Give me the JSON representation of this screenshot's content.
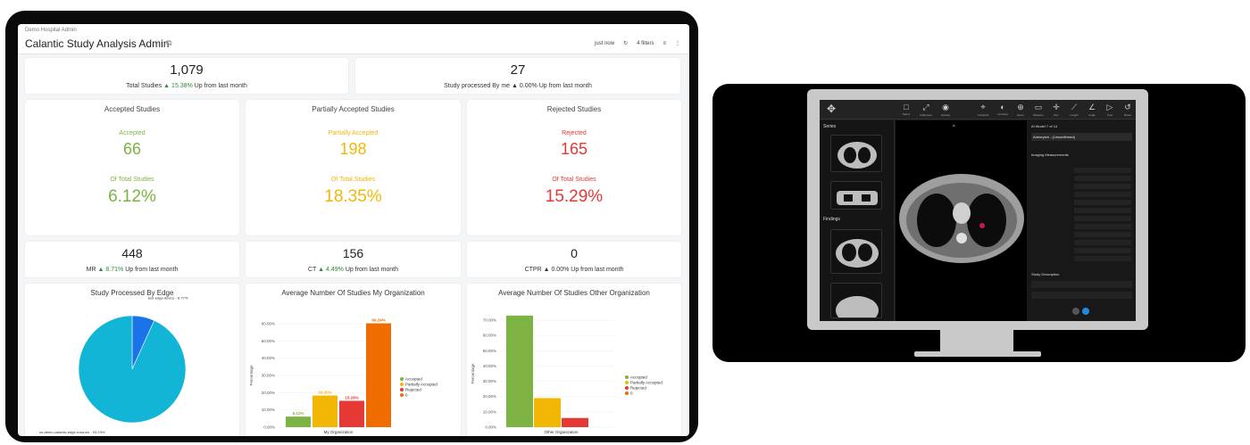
{
  "dashboard": {
    "breadcrumb": "Demo Hospital Admin",
    "title": "Calantic Study Analysis Admin",
    "refresh_text": "just now",
    "filters_text": "4 filters"
  },
  "kpi_top": [
    {
      "value": "1,079",
      "label": "Total Studies",
      "delta": "15.38%",
      "suffix": "Up from last month"
    },
    {
      "value": "27",
      "label": "Study processed By me",
      "delta": "0.00%",
      "suffix": "Up from last month"
    }
  ],
  "status_cards": [
    {
      "title": "Accepted Studies",
      "label": "Accepted",
      "count": "66",
      "pct_label": "Of Total Studies",
      "pct": "6.12%",
      "color": "#7cb342"
    },
    {
      "title": "Partially Accepted Studies",
      "label": "Partially Accepted",
      "count": "198",
      "pct_label": "Of Total Studies",
      "pct": "18.35%",
      "color": "#f2b705"
    },
    {
      "title": "Rejected Studies",
      "label": "Rejected",
      "count": "165",
      "pct_label": "Of Total Studies",
      "pct": "15.29%",
      "color": "#e53935"
    }
  ],
  "modality_cards": [
    {
      "value": "448",
      "label": "MR",
      "delta": "8.71%",
      "suffix": "Up from last month"
    },
    {
      "value": "156",
      "label": "CT",
      "delta": "4.49%",
      "suffix": "Up from last month"
    },
    {
      "value": "0",
      "label": "CTPR",
      "delta": "0.00%",
      "suffix": "Up from last month"
    }
  ],
  "chart_data": [
    {
      "type": "pie",
      "title": "Study Processed By Edge",
      "slices": [
        {
          "label": "test-edge-device - 6.77%",
          "value": 6.77,
          "color": "#1a73e8"
        },
        {
          "label": "us-demo-calantic-edge-rosa-wn - 93.23%",
          "value": 93.23,
          "color": "#13b5d6"
        }
      ]
    },
    {
      "type": "bar",
      "title": "Average Number Of Studies My Organization",
      "xlabel": "My Organization",
      "ylabel": "Percentage",
      "yticks": [
        "0.00%",
        "10.00%",
        "20.00%",
        "30.00%",
        "40.00%",
        "50.00%",
        "60.00%"
      ],
      "ylim": [
        0,
        60
      ],
      "series": [
        {
          "name": "Accepted",
          "value": 6.12,
          "label": "6.12%",
          "color": "#7cb342"
        },
        {
          "name": "Partially Accepted",
          "value": 18.35,
          "label": "18.35%",
          "color": "#f2b705"
        },
        {
          "name": "Rejected",
          "value": 15.29,
          "label": "15.29%",
          "color": "#e53935"
        },
        {
          "name": "0",
          "value": 60.24,
          "label": "60.24%",
          "color": "#ef6c00"
        }
      ]
    },
    {
      "type": "bar",
      "title": "Average Number Of Studies Other Organization",
      "xlabel": "Other Organization",
      "ylabel": "Percentage",
      "yticks": [
        "0.00%",
        "10.00%",
        "20.00%",
        "30.00%",
        "40.00%",
        "50.00%",
        "60.00%",
        "70.00%"
      ],
      "ylim": [
        0,
        70
      ],
      "series": [
        {
          "name": "Accepted",
          "value": 73,
          "color": "#7cb342"
        },
        {
          "name": "Partially Accepted",
          "value": 19,
          "color": "#f2b705"
        },
        {
          "name": "Rejected",
          "value": 6,
          "color": "#e53935"
        },
        {
          "name": "0",
          "value": 0,
          "color": "#ef6c00"
        }
      ]
    }
  ],
  "viewer": {
    "tools": [
      "Select",
      "Fullscreen",
      "Overlay",
      "Crosshair",
      "Contrast",
      "Zoom",
      "Measure",
      "Pan",
      "Length",
      "Angle",
      "Cine",
      "Reset"
    ],
    "left_sections": [
      "Series",
      "Findings"
    ],
    "top_text": "A",
    "right_header": "AI Model",
    "right_page": "7 of 14",
    "finding_name": "Aneurysm - (Unconfirmed)",
    "section_imaging": "Imaging Measurements",
    "section_study": "Study Description"
  }
}
